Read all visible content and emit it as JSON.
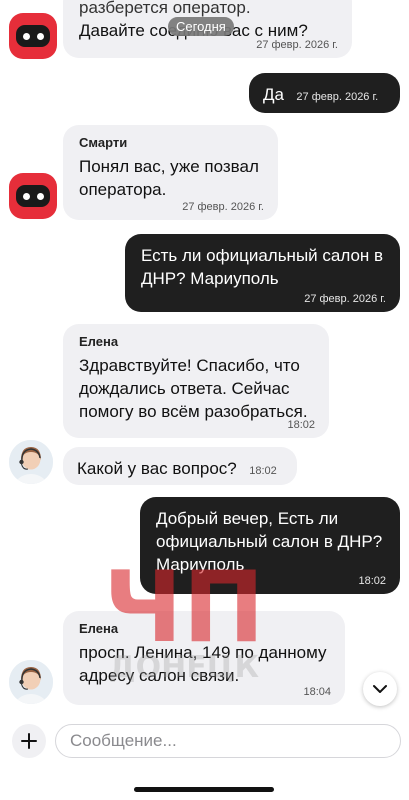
{
  "date_pill": "Сегодня",
  "messages": [
    {
      "id": "m1",
      "sender": "",
      "text": "разберется оператор.",
      "text2": "Давайте соединю вас с ним?",
      "time": "27 февр. 2026 г."
    },
    {
      "id": "m2",
      "text": "Да",
      "time": "27 февр. 2026 г."
    },
    {
      "id": "m3",
      "sender": "Смарти",
      "text": "Понял вас, уже позвал оператора.",
      "time": "27 февр. 2026 г."
    },
    {
      "id": "m4",
      "text": "Есть ли официальный салон в ДНР? Мариуполь",
      "time": "27 февр. 2026 г."
    },
    {
      "id": "m5",
      "sender": "Елена",
      "text": "Здравствуйте! Спасибо, что дождались ответа. Сейчас помогу во всём разобраться.",
      "time": "18:02"
    },
    {
      "id": "m6",
      "text": "Какой у вас вопрос?",
      "time": "18:02"
    },
    {
      "id": "m7",
      "text": "Добрый вечер, Есть ли официальный салон в ДНР? Мариуполь",
      "time": "18:02"
    },
    {
      "id": "m8",
      "sender": "Елена",
      "text": "просп. Ленина, 149 по данному адресу салон связи.",
      "time": "18:04"
    }
  ],
  "watermark": {
    "line1": "ЧП",
    "line2": "ДОНЕЦК"
  },
  "composer": {
    "placeholder": "Сообщение..."
  },
  "icons": {
    "add": "plus-icon",
    "scroll": "chevron-down-icon",
    "bot_avatar": "robot-avatar",
    "operator_avatar": "operator-avatar"
  },
  "colors": {
    "incoming_bubble": "#f0f0f3",
    "outgoing_bubble": "#1f1f1f",
    "bot_avatar": "#e62e3a",
    "watermark": "#d9262c"
  }
}
